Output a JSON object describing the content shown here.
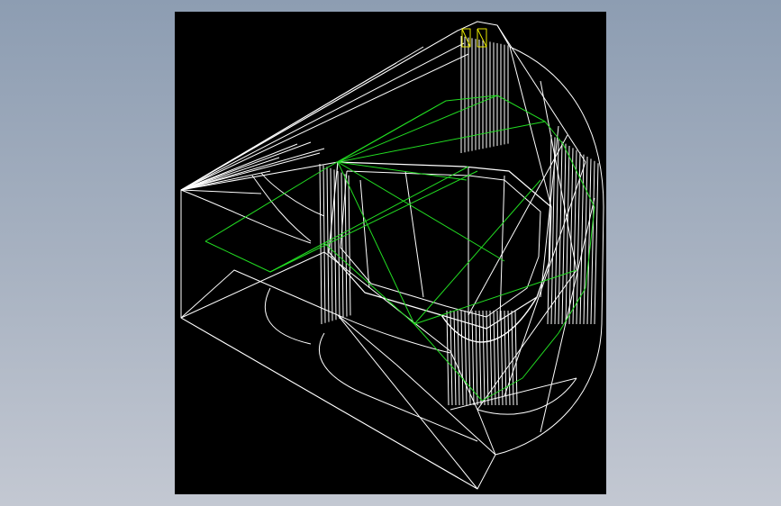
{
  "scene": {
    "background_color": "#000000",
    "colors": {
      "edges": "#ffffff",
      "sketch": "#22dd22",
      "origin": "#e8e800"
    }
  }
}
